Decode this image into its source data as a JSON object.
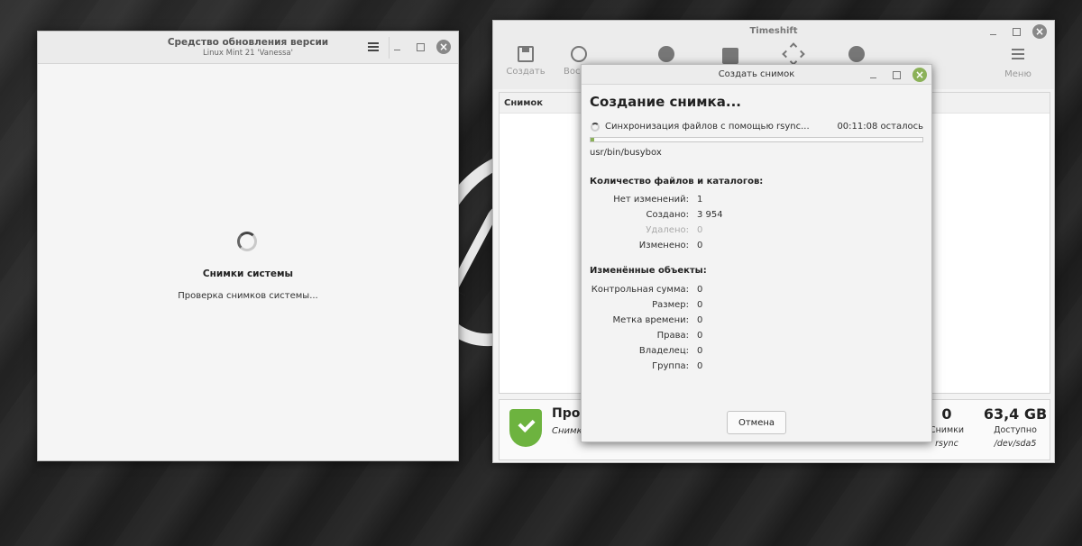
{
  "update_manager": {
    "title": "Средство обновления версии",
    "subtitle": "Linux Mint 21 'Vanessa'",
    "heading": "Снимки системы",
    "status": "Проверка снимков системы..."
  },
  "timeshift": {
    "title": "Timeshift",
    "toolbar": {
      "create": "Создать",
      "restore_partial": "Вос",
      "menu": "Меню"
    },
    "list_header": "Снимок",
    "status_title_partial": "Про",
    "status_sub_partial": "Снимк",
    "stats": [
      {
        "value": "0",
        "label": "Снимки",
        "sub": "rsync"
      },
      {
        "value": "63,4 GB",
        "label": "Доступно",
        "sub": "/dev/sda5"
      }
    ]
  },
  "dialog": {
    "title": "Создать снимок",
    "heading": "Создание снимка...",
    "progress_label": "Синхронизация файлов с помощью rsync...",
    "time_left": "00:11:08 осталось",
    "progress": 0.01,
    "current_file": "usr/bin/busybox",
    "files_section": "Количество файлов и каталогов:",
    "files": [
      {
        "key": "Нет изменений:",
        "value": "1",
        "muted": false
      },
      {
        "key": "Создано:",
        "value": "3 954",
        "muted": false
      },
      {
        "key": "Удалено:",
        "value": "0",
        "muted": true
      },
      {
        "key": "Изменено:",
        "value": "0",
        "muted": false
      }
    ],
    "changed_section": "Изменённые объекты:",
    "changed": [
      {
        "key": "Контрольная сумма:",
        "value": "0"
      },
      {
        "key": "Размер:",
        "value": "0"
      },
      {
        "key": "Метка времени:",
        "value": "0"
      },
      {
        "key": "Права:",
        "value": "0"
      },
      {
        "key": "Владелец:",
        "value": "0"
      },
      {
        "key": "Группа:",
        "value": "0"
      }
    ],
    "cancel": "Отмена"
  },
  "colors": {
    "accent": "#8bb158",
    "shield": "#6db33f"
  }
}
